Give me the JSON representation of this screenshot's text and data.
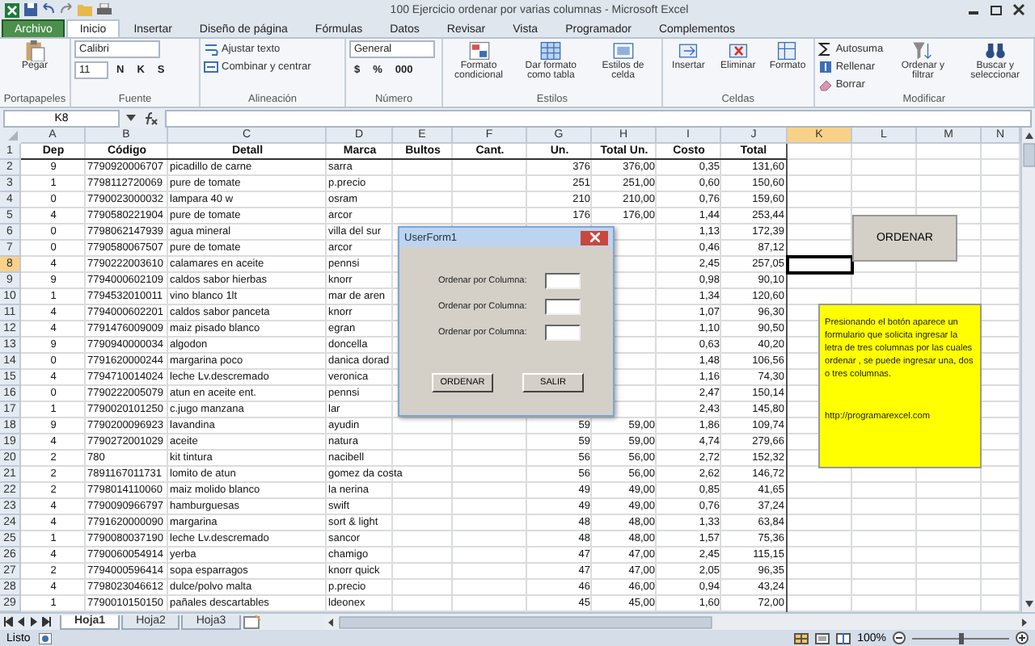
{
  "window": {
    "title": "100 Ejercicio ordenar por varias columnas - Microsoft Excel"
  },
  "tabs": [
    {
      "label": "Archivo",
      "kind": "file",
      "selected": false
    },
    {
      "label": "Inicio",
      "kind": "tab",
      "selected": true
    },
    {
      "label": "Insertar",
      "kind": "tab",
      "selected": false
    },
    {
      "label": "Diseño de página",
      "kind": "tab",
      "selected": false
    },
    {
      "label": "Fórmulas",
      "kind": "tab",
      "selected": false
    },
    {
      "label": "Datos",
      "kind": "tab",
      "selected": false
    },
    {
      "label": "Revisar",
      "kind": "tab",
      "selected": false
    },
    {
      "label": "Vista",
      "kind": "tab",
      "selected": false
    },
    {
      "label": "Programador",
      "kind": "tab",
      "selected": false
    },
    {
      "label": "Complementos",
      "kind": "tab",
      "selected": false
    }
  ],
  "ribbon": {
    "groups": [
      {
        "label": "Portapapeles",
        "kind": "stack",
        "controls": [
          {
            "kind": "large",
            "label": "Pegar"
          }
        ]
      },
      {
        "label": "Fuente",
        "kind": "flow",
        "controls": [
          {
            "kind": "field",
            "value": "Calibri"
          },
          {
            "kind": "field",
            "value": "11"
          },
          {
            "kind": "toggle",
            "label": "N"
          },
          {
            "kind": "toggle",
            "label": "K"
          },
          {
            "kind": "toggle",
            "label": "S"
          }
        ]
      },
      {
        "label": "Alineación",
        "kind": "stack",
        "controls": [
          {
            "kind": "small",
            "label": "Ajustar texto"
          },
          {
            "kind": "small",
            "label": "Combinar y centrar"
          }
        ]
      },
      {
        "label": "Número",
        "kind": "flow",
        "controls": [
          {
            "kind": "field",
            "value": "General"
          },
          {
            "kind": "toggle",
            "label": "$"
          },
          {
            "kind": "toggle",
            "label": "%"
          },
          {
            "kind": "toggle",
            "label": "000"
          }
        ]
      },
      {
        "label": "Estilos",
        "kind": "stack",
        "controls": [
          {
            "kind": "large",
            "label": "Formato condicional"
          },
          {
            "kind": "large",
            "label": "Dar formato como tabla"
          },
          {
            "kind": "large",
            "label": "Estilos de celda"
          }
        ]
      },
      {
        "label": "Celdas",
        "kind": "stack",
        "controls": [
          {
            "kind": "large",
            "label": "Insertar"
          },
          {
            "kind": "large",
            "label": "Eliminar"
          },
          {
            "kind": "large",
            "label": "Formato"
          }
        ]
      },
      {
        "label": "Modificar",
        "kind": "stack",
        "controls": [
          {
            "kind": "small",
            "label": "Autosuma"
          },
          {
            "kind": "small",
            "label": "Rellenar"
          },
          {
            "kind": "small",
            "label": "Borrar"
          },
          {
            "kind": "large",
            "label": "Ordenar y filtrar"
          },
          {
            "kind": "large",
            "label": "Buscar y seleccionar"
          }
        ]
      }
    ]
  },
  "formula_bar": {
    "name_box": "K8"
  },
  "columns": [
    {
      "label": "A",
      "selected": false
    },
    {
      "label": "B",
      "selected": false
    },
    {
      "label": "C",
      "selected": false
    },
    {
      "label": "D",
      "selected": false
    },
    {
      "label": "E",
      "selected": false
    },
    {
      "label": "F",
      "selected": false
    },
    {
      "label": "G",
      "selected": false
    },
    {
      "label": "H",
      "selected": false
    },
    {
      "label": "I",
      "selected": false
    },
    {
      "label": "J",
      "selected": false
    },
    {
      "label": "K",
      "selected": true
    },
    {
      "label": "L",
      "selected": false
    },
    {
      "label": "M",
      "selected": false
    },
    {
      "label": "N",
      "selected": false
    }
  ],
  "rows": [
    {
      "number": "1",
      "kind": "header",
      "selected": false,
      "cells": {
        "a": "Dep",
        "b": "Código",
        "c": "Detall",
        "d": "Marca",
        "e": "Bultos",
        "f": "Cant.",
        "g": "Un.",
        "h": "Total Un.",
        "i": "Costo",
        "j": "Total"
      }
    },
    {
      "number": "2",
      "kind": "data",
      "selected": false,
      "cells": {
        "a": "9",
        "b": "7790920006707",
        "c": "picadillo de carne",
        "d": "sarra",
        "g": "376",
        "h": "376,00",
        "i": "0,35",
        "j": "131,60"
      }
    },
    {
      "number": "3",
      "kind": "data",
      "selected": false,
      "cells": {
        "a": "1",
        "b": "7798112720069",
        "c": "pure de tomate",
        "d": "p.precio",
        "g": "251",
        "h": "251,00",
        "i": "0,60",
        "j": "150,60"
      }
    },
    {
      "number": "4",
      "kind": "data",
      "selected": false,
      "cells": {
        "a": "0",
        "b": "7790023000032",
        "c": "lampara 40 w",
        "d": "osram",
        "g": "210",
        "h": "210,00",
        "i": "0,76",
        "j": "159,60"
      }
    },
    {
      "number": "5",
      "kind": "data",
      "selected": false,
      "cells": {
        "a": "4",
        "b": "7790580221904",
        "c": "pure de tomate",
        "d": "arcor",
        "g": "176",
        "h": "176,00",
        "i": "1,44",
        "j": "253,44"
      }
    },
    {
      "number": "6",
      "kind": "data",
      "selected": false,
      "cells": {
        "a": "0",
        "b": "7798062147939",
        "c": "agua mineral",
        "d": "villa del sur",
        "i": "1,13",
        "j": "172,39"
      }
    },
    {
      "number": "7",
      "kind": "data",
      "selected": false,
      "cells": {
        "a": "0",
        "b": "7790580067507",
        "c": "pure de tomate",
        "d": "arcor",
        "i": "0,46",
        "j": "87,12"
      }
    },
    {
      "number": "8",
      "kind": "data",
      "selected": true,
      "cells": {
        "a": "4",
        "b": "7790222003610",
        "c": "calamares en aceite",
        "d": "pennsi",
        "i": "2,45",
        "j": "257,05"
      }
    },
    {
      "number": "9",
      "kind": "data",
      "selected": false,
      "cells": {
        "a": "9",
        "b": "7794000602109",
        "c": "caldos sabor hierbas",
        "d": "knorr",
        "i": "0,98",
        "j": "90,10"
      }
    },
    {
      "number": "10",
      "kind": "data",
      "selected": false,
      "cells": {
        "a": "1",
        "b": "7794532010011",
        "c": "vino blanco 1lt",
        "d": "mar de aren",
        "i": "1,34",
        "j": "120,60"
      }
    },
    {
      "number": "11",
      "kind": "data",
      "selected": false,
      "cells": {
        "a": "4",
        "b": "7794000602201",
        "c": "caldos sabor panceta",
        "d": "knorr",
        "i": "1,07",
        "j": "96,30"
      }
    },
    {
      "number": "12",
      "kind": "data",
      "selected": false,
      "cells": {
        "a": "4",
        "b": "7791476009009",
        "c": "maiz pisado blanco",
        "d": "egran",
        "i": "1,10",
        "j": "90,50"
      }
    },
    {
      "number": "13",
      "kind": "data",
      "selected": false,
      "cells": {
        "a": "9",
        "b": "7790940000034",
        "c": "algodon",
        "d": "doncella",
        "i": "0,63",
        "j": "40,20"
      }
    },
    {
      "number": "14",
      "kind": "data",
      "selected": false,
      "cells": {
        "a": "0",
        "b": "7791620000244",
        "c": "margarina poco",
        "d": "danica dorad",
        "i": "1,48",
        "j": "106,56"
      }
    },
    {
      "number": "15",
      "kind": "data",
      "selected": false,
      "cells": {
        "a": "4",
        "b": "7794710014024",
        "c": "leche Lv.descremado",
        "d": "veronica",
        "i": "1,16",
        "j": "74,30"
      }
    },
    {
      "number": "16",
      "kind": "data",
      "selected": false,
      "cells": {
        "a": "0",
        "b": "7790222005079",
        "c": "atun en aceite ent.",
        "d": "pennsi",
        "i": "2,47",
        "j": "150,14"
      }
    },
    {
      "number": "17",
      "kind": "data",
      "selected": false,
      "cells": {
        "a": "1",
        "b": "7790020101250",
        "c": "c.jugo manzana",
        "d": "lar",
        "i": "2,43",
        "j": "145,80"
      }
    },
    {
      "number": "18",
      "kind": "data",
      "selected": false,
      "cells": {
        "a": "9",
        "b": "7790200096923",
        "c": "lavandina",
        "d": "ayudin",
        "g": "59",
        "h": "59,00",
        "i": "1,86",
        "j": "109,74"
      }
    },
    {
      "number": "19",
      "kind": "data",
      "selected": false,
      "cells": {
        "a": "4",
        "b": "7790272001029",
        "c": "aceite",
        "d": "natura",
        "g": "59",
        "h": "59,00",
        "i": "4,74",
        "j": "279,66"
      }
    },
    {
      "number": "20",
      "kind": "data",
      "selected": false,
      "cells": {
        "a": "2",
        "b": "780",
        "c": "kit tintura",
        "d": "nacibell",
        "g": "56",
        "h": "56,00",
        "i": "2,72",
        "j": "152,32"
      }
    },
    {
      "number": "21",
      "kind": "data",
      "selected": false,
      "cells": {
        "a": "2",
        "b": "7891167011731",
        "c": "lomito de atun",
        "d": "gomez da costa",
        "g": "56",
        "h": "56,00",
        "i": "2,62",
        "j": "146,72"
      }
    },
    {
      "number": "22",
      "kind": "data",
      "selected": false,
      "cells": {
        "a": "2",
        "b": "7798014110060",
        "c": "maiz molido blanco",
        "d": "la nerina",
        "g": "49",
        "h": "49,00",
        "i": "0,85",
        "j": "41,65"
      }
    },
    {
      "number": "23",
      "kind": "data",
      "selected": false,
      "cells": {
        "a": "4",
        "b": "7790090966797",
        "c": "hamburguesas",
        "d": "swift",
        "g": "49",
        "h": "49,00",
        "i": "0,76",
        "j": "37,24"
      }
    },
    {
      "number": "24",
      "kind": "data",
      "selected": false,
      "cells": {
        "a": "4",
        "b": "7791620000090",
        "c": "margarina",
        "d": "sort & light",
        "g": "48",
        "h": "48,00",
        "i": "1,33",
        "j": "63,84"
      }
    },
    {
      "number": "25",
      "kind": "data",
      "selected": false,
      "cells": {
        "a": "1",
        "b": "7790080037190",
        "c": "leche Lv.descremado",
        "d": "sancor",
        "g": "48",
        "h": "48,00",
        "i": "1,57",
        "j": "75,36"
      }
    },
    {
      "number": "26",
      "kind": "data",
      "selected": false,
      "cells": {
        "a": "4",
        "b": "7790060054914",
        "c": "yerba",
        "d": "chamigo",
        "g": "47",
        "h": "47,00",
        "i": "2,45",
        "j": "115,15"
      }
    },
    {
      "number": "27",
      "kind": "data",
      "selected": false,
      "cells": {
        "a": "2",
        "b": "7794000596414",
        "c": "sopa esparragos",
        "d": "knorr quick",
        "g": "47",
        "h": "47,00",
        "i": "2,05",
        "j": "96,35"
      }
    },
    {
      "number": "28",
      "kind": "data",
      "selected": false,
      "cells": {
        "a": "4",
        "b": "7798023046612",
        "c": "dulce/polvo malta",
        "d": "p.precio",
        "g": "46",
        "h": "46,00",
        "i": "0,94",
        "j": "43,24"
      }
    },
    {
      "number": "29",
      "kind": "data",
      "selected": false,
      "cells": {
        "a": "1",
        "b": "7790010150150",
        "c": "pañales descartables",
        "d": "ldeonex",
        "g": "45",
        "h": "45,00",
        "i": "1,60",
        "j": "72,00"
      }
    }
  ],
  "sheet_button": {
    "label": "ORDENAR"
  },
  "note": {
    "text": "Presionando el botón aparece un formulario que solicita ingresar la letra de tres columnas por las cuales ordenar , se puede ingresar una, dos o tres columnas.",
    "link": "http://programarexcel.com"
  },
  "dialog": {
    "title": "UserForm1",
    "fields": [
      {
        "label": "Ordenar por Columna:"
      },
      {
        "label": "Ordenar por Columna:"
      },
      {
        "label": "Ordenar por Columna:"
      }
    ],
    "buttons": [
      {
        "label": "ORDENAR"
      },
      {
        "label": "SALIR"
      }
    ]
  },
  "sheet_tabs": [
    {
      "label": "Hoja1",
      "selected": true
    },
    {
      "label": "Hoja2",
      "selected": false
    },
    {
      "label": "Hoja3",
      "selected": false
    }
  ],
  "status_bar": {
    "status": "Listo",
    "zoom": "100%",
    "zoom_slider": {
      "level": 0.5
    }
  }
}
